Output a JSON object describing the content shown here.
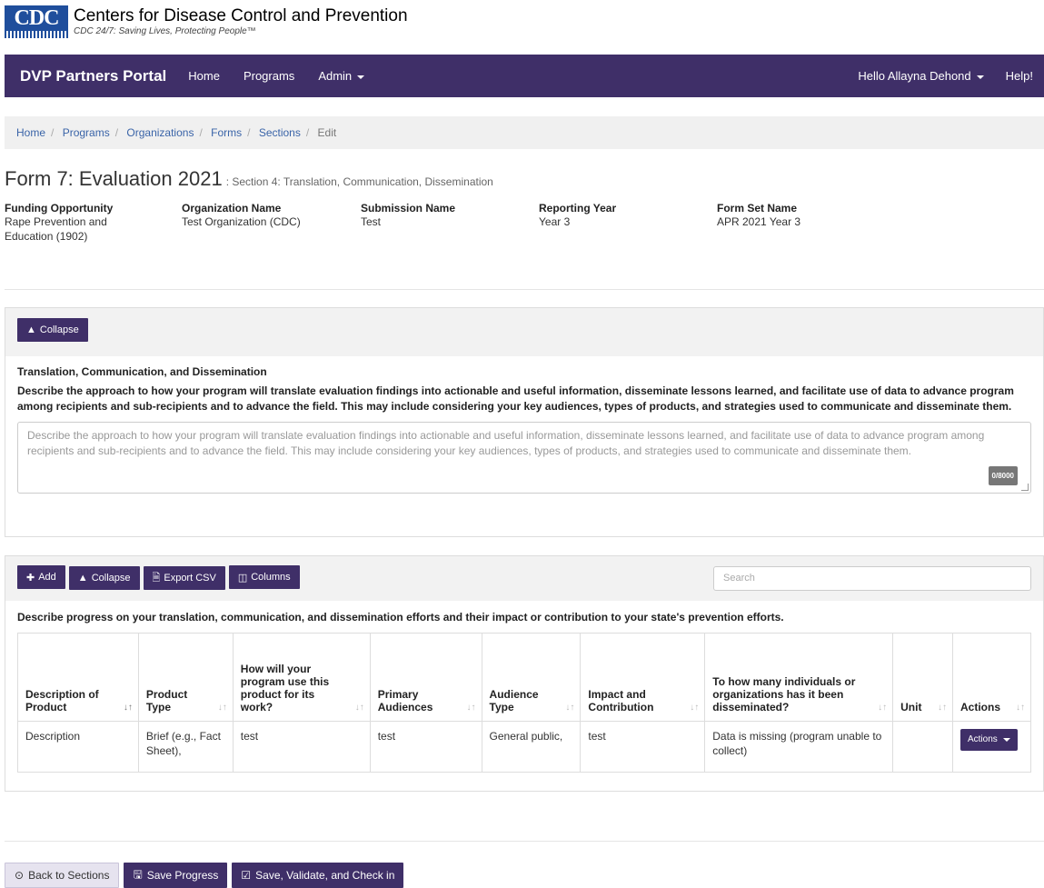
{
  "header": {
    "logo_text": "CDC",
    "title": "Centers for Disease Control and Prevention",
    "tagline": "CDC 24/7: Saving Lives, Protecting People™"
  },
  "navbar": {
    "brand": "DVP Partners Portal",
    "items": [
      "Home",
      "Programs",
      "Admin"
    ],
    "user": "Hello Allayna Dehond",
    "help": "Help!",
    "bg_color": "#3f2f68"
  },
  "breadcrumb": [
    "Home",
    "Programs",
    "Organizations",
    "Forms",
    "Sections",
    "Edit"
  ],
  "page": {
    "title": "Form 7: Evaluation 2021",
    "subtitle": ": Section 4: Translation, Communication, Dissemination"
  },
  "meta": [
    {
      "label": "Funding Opportunity",
      "value": "Rape Prevention and Education (1902)"
    },
    {
      "label": "Organization Name",
      "value": "Test Organization (CDC)"
    },
    {
      "label": "Submission Name",
      "value": "Test"
    },
    {
      "label": "Reporting Year",
      "value": "Year 3"
    },
    {
      "label": "Form Set Name",
      "value": "APR 2021 Year 3"
    }
  ],
  "section1": {
    "collapse_label": "Collapse",
    "title": "Translation, Communication, and Dissemination",
    "description": "Describe the approach to how your program will translate evaluation findings into actionable and useful information, disseminate lessons learned, and facilitate use of data to advance program among recipients and sub-recipients and to advance the field. This may include considering your key audiences, types of products, and strategies used to communicate and disseminate them.",
    "placeholder": "Describe the approach to how your program will translate evaluation findings into actionable and useful information, disseminate lessons learned, and facilitate use of data to advance program among recipients and sub-recipients and to advance the field.  This may include considering your key audiences, types of products, and strategies used to communicate and disseminate them.",
    "counter": "0/8000"
  },
  "section2": {
    "buttons": {
      "add": "Add",
      "collapse": "Collapse",
      "export": "Export CSV",
      "columns": "Columns"
    },
    "search_placeholder": "Search",
    "description": "Describe progress on your translation, communication, and dissemination efforts and their impact or contribution to your state's prevention efforts.",
    "columns": [
      "Description of Product",
      "Product Type",
      "How will your program use this product for its work?",
      "Primary Audiences",
      "Audience Type",
      "Impact and Contribution",
      "To how many individuals or organizations has it been disseminated?",
      "Unit",
      "Actions"
    ],
    "rows": [
      {
        "description": "Description",
        "product_type": "Brief (e.g., Fact Sheet),",
        "use": "test",
        "primary_audiences": "test",
        "audience_type": "General public,",
        "impact": "test",
        "disseminated": "Data is missing (program unable to collect)",
        "unit": "",
        "actions": "Actions"
      }
    ]
  },
  "bottom": {
    "back": "Back to Sections",
    "save": "Save Progress",
    "validate": "Save, Validate, and Check in"
  }
}
